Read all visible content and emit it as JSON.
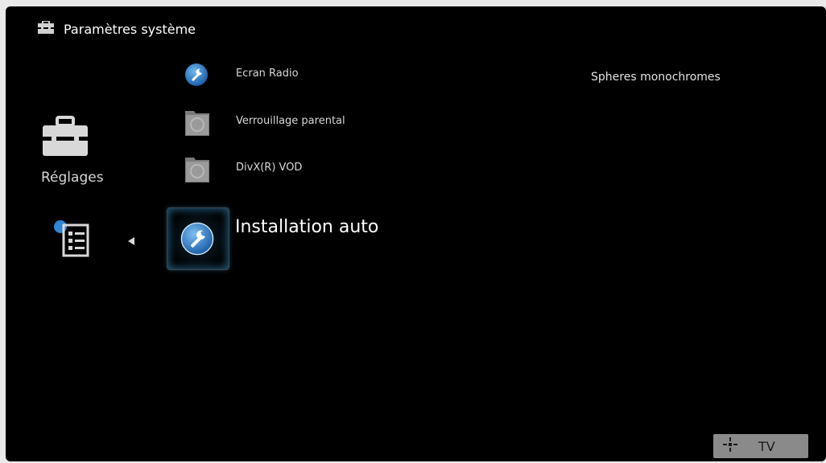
{
  "header": {
    "title": "Paramètres système",
    "icon": "toolbox-icon"
  },
  "category": {
    "label": "Réglages",
    "icon": "toolbox-icon"
  },
  "menu": {
    "items": [
      {
        "label": "Ecran Radio",
        "icon": "wrench-icon"
      },
      {
        "label": "Verrouillage parental",
        "icon": "folder-icon"
      },
      {
        "label": "DivX(R) VOD",
        "icon": "folder-icon"
      }
    ],
    "selected": {
      "label": "Installation auto",
      "icon": "wrench-icon"
    }
  },
  "info": {
    "text": "Spheres monochromes"
  },
  "footer": {
    "badge_label": "TV",
    "badge_icon": "navigation-icon"
  },
  "colors": {
    "background": "#000000",
    "accent": "#2f86d6",
    "text": "#ffffff"
  }
}
